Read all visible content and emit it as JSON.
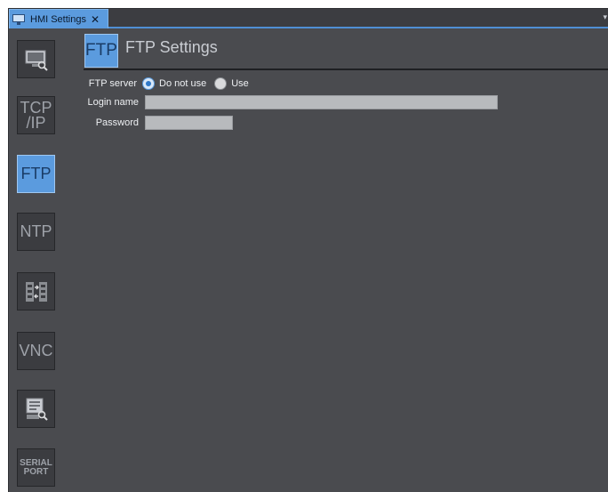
{
  "tab": {
    "title": "HMI Settings",
    "close": "✕",
    "menu": "▾"
  },
  "rail": {
    "items": [
      {
        "name": "display-settings-icon",
        "label": ""
      },
      {
        "name": "tcpip-icon",
        "label": "TCP/IP",
        "line1": "TCP",
        "line2": "/IP"
      },
      {
        "name": "ftp-icon",
        "label": "FTP",
        "selected": true
      },
      {
        "name": "ntp-icon",
        "label": "NTP"
      },
      {
        "name": "data-exchange-icon",
        "label": ""
      },
      {
        "name": "vnc-icon",
        "label": "VNC"
      },
      {
        "name": "maintenance-icon",
        "label": ""
      },
      {
        "name": "serial-port-icon",
        "label": "SERIAL PORT",
        "line1": "SERIAL",
        "line2": "PORT"
      }
    ]
  },
  "header": {
    "badge": "FTP",
    "title": "FTP Settings"
  },
  "form": {
    "ftp_server": {
      "label": "FTP server",
      "options": [
        "Do not use",
        "Use"
      ],
      "selected": "Do not use"
    },
    "login_name": {
      "label": "Login name",
      "value": ""
    },
    "password": {
      "label": "Password",
      "value": ""
    }
  },
  "colors": {
    "accent": "#5b9bde",
    "background": "#4a4b4f",
    "rail_button": "#3b3c40"
  }
}
